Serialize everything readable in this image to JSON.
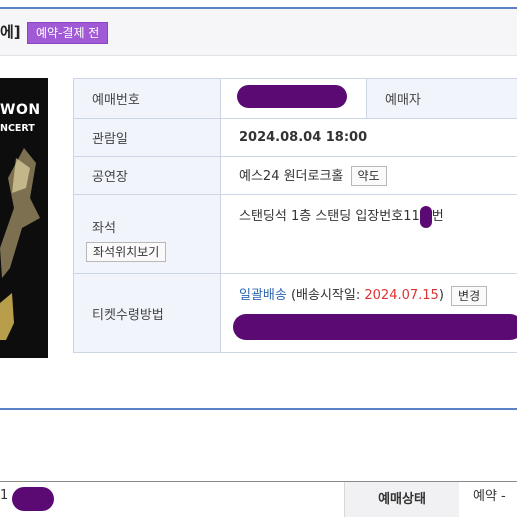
{
  "header": {
    "title_fragment": "에]",
    "badge": "예약-결제 전"
  },
  "poster": {
    "line1": "WON",
    "line2": "NCERT"
  },
  "info": {
    "booking_number_label": "예매번호",
    "booker_label": "예매자",
    "date_label": "관람일",
    "date_value": "2024.08.04 18:00",
    "venue_label": "공연장",
    "venue_value": "예스24 원더로크홀",
    "map_button": "약도",
    "seat_label": "좌석",
    "seat_view_button": "좌석위치보기",
    "seat_value": "스탠딩석 1층 스탠딩 입장번호11",
    "seat_suffix": "번",
    "ticket_method_label": "티켓수령방법",
    "delivery_link": "일괄배송",
    "delivery_paren_open": "(배송시작일:",
    "delivery_date": "2024.07.15",
    "delivery_paren_close": ")",
    "change_button": "변경"
  },
  "bottom": {
    "prefix": "1",
    "status_label": "예매상태",
    "status_value": "예약 -"
  },
  "colors": {
    "accent_line": "#5a80c6",
    "badge_bg": "#a05ad6",
    "redaction": "#5b0a73",
    "date_red": "#d33333",
    "link_blue": "#2f66b3"
  }
}
